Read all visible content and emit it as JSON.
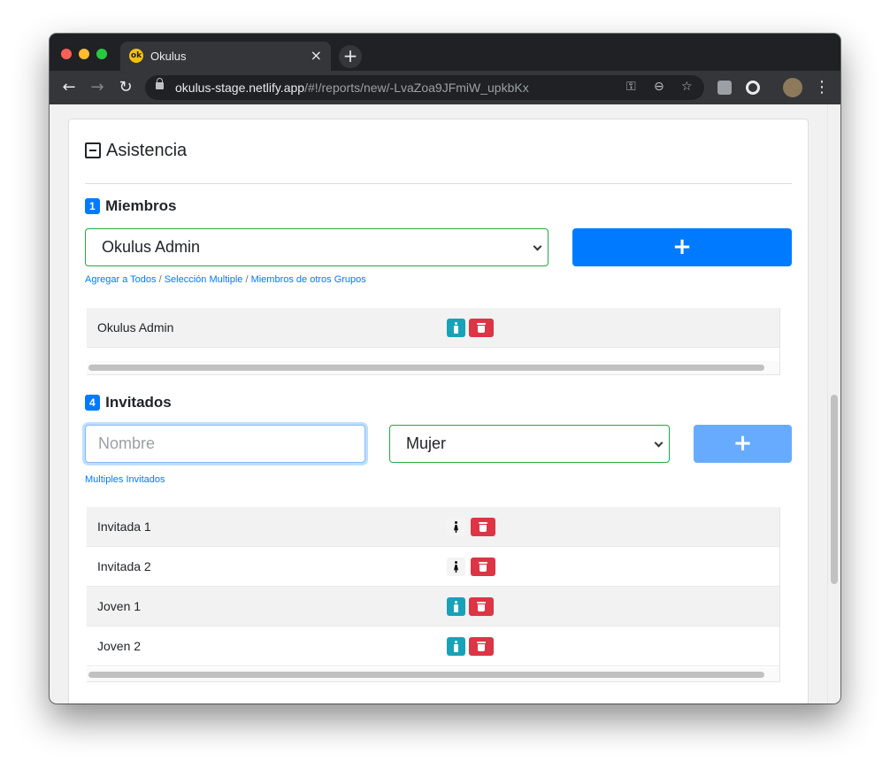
{
  "browser": {
    "tab_title": "Okulus",
    "favicon_text": "ok",
    "tab_close": "×",
    "new_tab": "+",
    "url_host": "okulus-stage.netlify.app",
    "url_path": "/#!/reports/new/-LvaZoa9JFmiW_upkbKx",
    "icons": [
      "back-icon",
      "forward-icon",
      "reload-icon",
      "lock-icon",
      "key-icon",
      "zoom-icon",
      "star-icon",
      "extension-icon",
      "profile-avatar",
      "menu-icon"
    ],
    "glyphs": {
      "back": "←",
      "forward": "→",
      "reload": "↻",
      "key": "⚿",
      "zoom": "⊖",
      "star": "☆",
      "menu": "⋮"
    }
  },
  "section": {
    "title": "Asistencia"
  },
  "members": {
    "count": "1",
    "title": "Miembros",
    "selected": "Okulus Admin",
    "add_label": "+",
    "links": {
      "add_all": "Agregar a Todos",
      "separator": "/",
      "multi_select": "Selección Multiple",
      "other_groups": "Miembros de otros Grupos"
    },
    "rows": [
      {
        "name": "Okulus Admin",
        "gender": "male"
      }
    ]
  },
  "guests": {
    "count": "4",
    "title": "Invitados",
    "name_placeholder": "Nombre",
    "gender_selected": "Mujer",
    "add_label": "+",
    "link_multi": "Multiples Invitados",
    "rows": [
      {
        "name": "Invitada 1",
        "gender": "female"
      },
      {
        "name": "Invitada 2",
        "gender": "female"
      },
      {
        "name": "Joven 1",
        "gender": "male"
      },
      {
        "name": "Joven 2",
        "gender": "male"
      }
    ]
  },
  "colors": {
    "primary": "#007bff",
    "success_border": "#28a745",
    "info": "#17a2b8",
    "danger": "#dc3545"
  }
}
